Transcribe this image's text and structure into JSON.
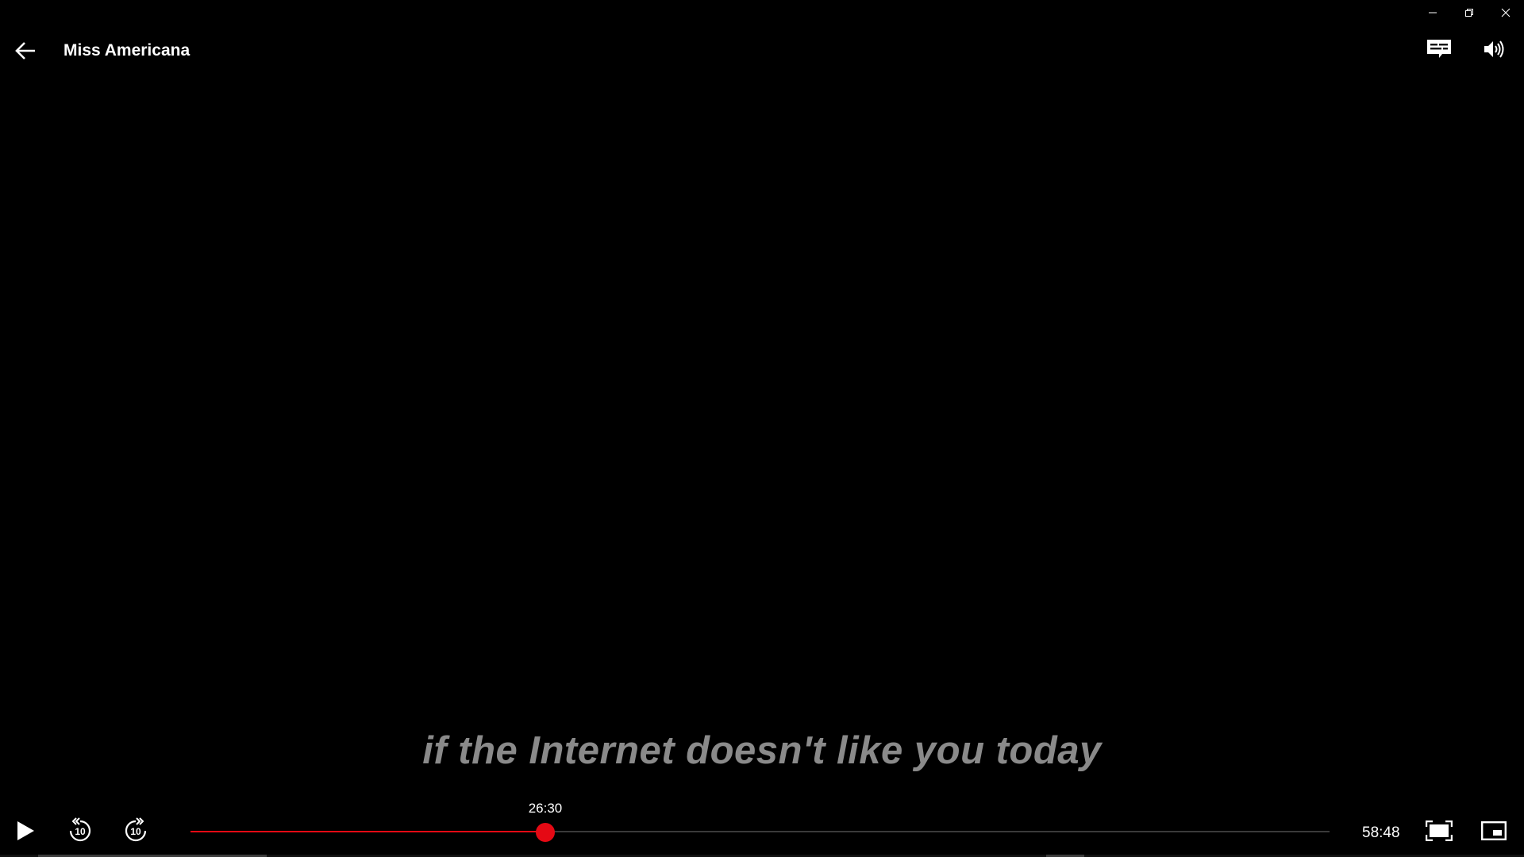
{
  "window": {
    "minimize_icon": "minimize-icon",
    "restore_icon": "restore-icon",
    "close_icon": "close-icon"
  },
  "header": {
    "back_icon": "arrow-left-icon",
    "title": "Miss Americana",
    "subtitles_icon": "subtitles-icon",
    "volume_icon": "speaker-icon"
  },
  "subtitle": {
    "text": "if the Internet doesn't like you today"
  },
  "controls": {
    "play_icon": "play-icon",
    "rewind_icon": "rewind-10-icon",
    "rewind_label": "10",
    "forward_icon": "forward-10-icon",
    "forward_label": "10",
    "current_time": "26:30",
    "duration": "58:48",
    "progress_fraction": 0.3115,
    "fullscreen_icon": "fullscreen-icon",
    "pip_icon": "picture-in-picture-icon"
  },
  "colors": {
    "accent": "#e50914",
    "subtitle": "#8a8a8a",
    "background": "#000000"
  }
}
